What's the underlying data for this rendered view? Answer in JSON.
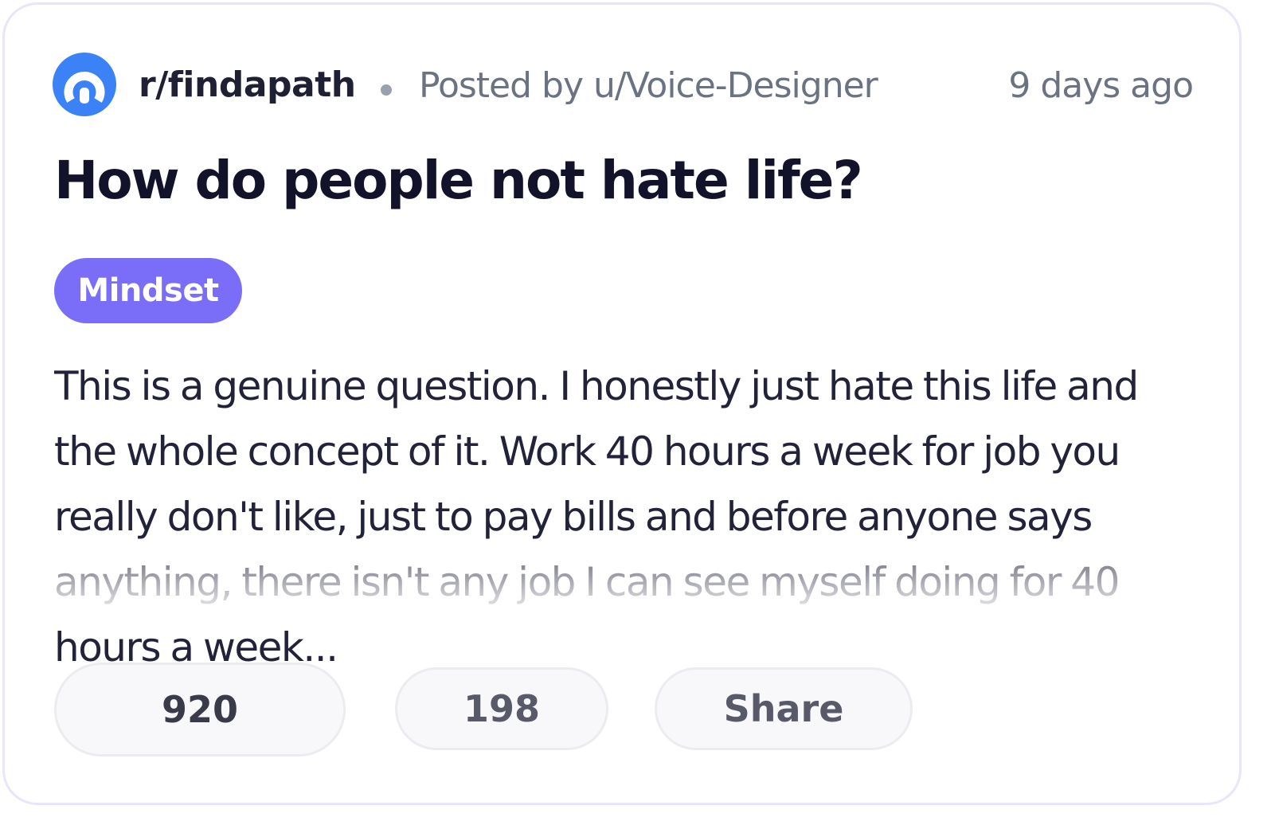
{
  "post": {
    "subreddit": "r/findapath",
    "posted_by": "Posted by u/Voice-Designer",
    "time_ago": "9 days ago",
    "title": "How do people not hate life?",
    "tag": "Mindset",
    "body": "This is a genuine question. I honestly just hate this life and the whole concept of it. Work 40 hours a week for job you really don't like, just to pay bills and before anyone says anything, there isn't any job I can see myself doing for 40 hours a week...",
    "colors": {
      "avatar": "#3b82f6",
      "tag_background": "#7a6ef8",
      "title": "#12132a"
    }
  },
  "actions": {
    "upvotes": "920",
    "comments": "198",
    "share_label": "Share"
  }
}
